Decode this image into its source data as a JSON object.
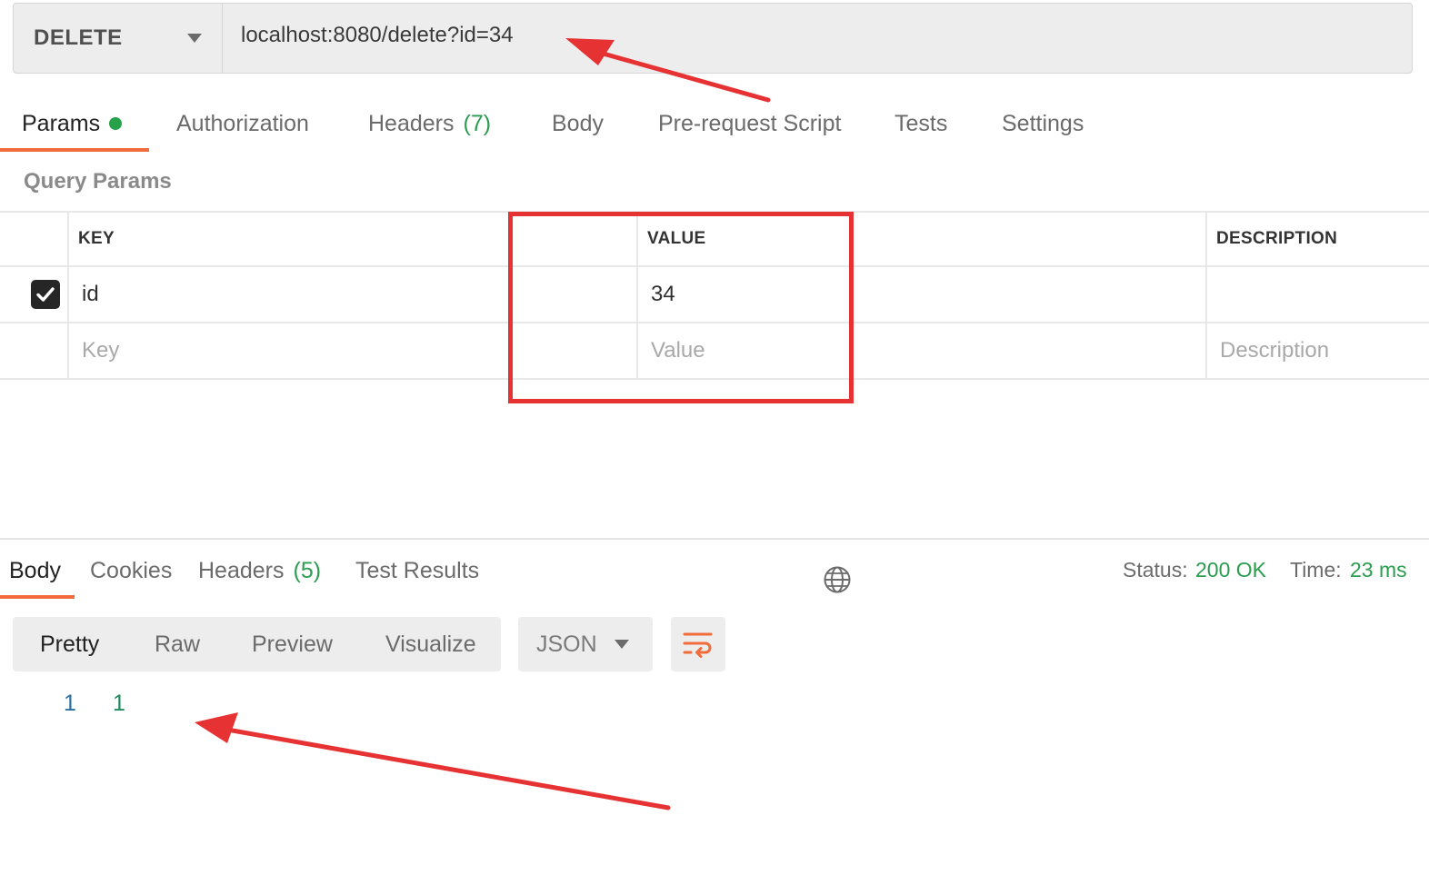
{
  "request": {
    "method": "DELETE",
    "url": "localhost:8080/delete?id=34"
  },
  "request_tabs": {
    "params": "Params",
    "authorization": "Authorization",
    "headers": "Headers",
    "headers_count": "(7)",
    "body": "Body",
    "pre_request": "Pre-request Script",
    "tests": "Tests",
    "settings": "Settings"
  },
  "query_params": {
    "title": "Query Params",
    "columns": {
      "key": "KEY",
      "value": "VALUE",
      "description": "DESCRIPTION"
    },
    "rows": [
      {
        "key": "id",
        "value": "34",
        "description": "",
        "checked": true
      }
    ],
    "placeholders": {
      "key": "Key",
      "value": "Value",
      "description": "Description"
    }
  },
  "response_tabs": {
    "body": "Body",
    "cookies": "Cookies",
    "headers": "Headers",
    "headers_count": "(5)",
    "test_results": "Test Results"
  },
  "response_status": {
    "status_label": "Status:",
    "status_value": "200 OK",
    "time_label": "Time:",
    "time_value": "23 ms"
  },
  "response_view": {
    "modes": [
      "Pretty",
      "Raw",
      "Preview",
      "Visualize"
    ],
    "format": "JSON"
  },
  "response_body": {
    "line_number": "1",
    "value": "1"
  },
  "colors": {
    "accent": "#f26b3a",
    "success": "#2a9d4f",
    "annotation": "#e63232"
  }
}
